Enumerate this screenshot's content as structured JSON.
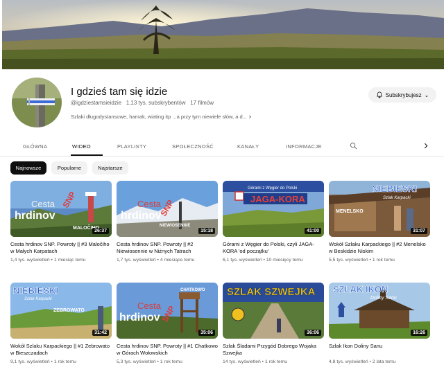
{
  "channel": {
    "title": "I gdzieś tam się idzie",
    "handle": "@igdziestamsieidzie",
    "subscribers": "1,13 tys. subskrybentów",
    "videos_count": "17 filmów",
    "description": "Szlaki długodystansowe, hamak, wiating itp ...a przy tym niewiele słów, a d...",
    "subscribe_label": "Subskrybujesz"
  },
  "tabs": [
    "GŁÓWNA",
    "WIDEO",
    "PLAYLISTY",
    "SPOŁECZNOŚĆ",
    "KANAŁY",
    "INFORMACJE"
  ],
  "active_tab": "WIDEO",
  "chips": [
    "Najnowsze",
    "Popularne",
    "Najstarsze"
  ],
  "active_chip": "Najnowsze",
  "icons": [
    "bell-icon",
    "search-icon",
    "chevron-right-icon",
    "chevron-right-small-icon"
  ],
  "videos": [
    {
      "title": "Cesta hrdinov SNP. Powroty || #3 Maločiho w Małych Karpatach",
      "views": "1,4 tys. wyświetleń",
      "age": "1 miesiąc temu",
      "duration": "26:37",
      "thumb_text": [
        "Cesta",
        "hrdinov",
        "SNP",
        "MALOČIHO"
      ]
    },
    {
      "title": "Cesta hrdinov SNP. Powroty || #2 Niewiosennie w Niżnych Tatrach",
      "views": "1,7 tys. wyświetleń",
      "age": "4 miesiące temu",
      "duration": "15:18",
      "thumb_text": [
        "Cesta",
        "hrdinov",
        "SNP",
        "NIEWIOSENNIE"
      ]
    },
    {
      "title": "Górami z Węgier do Polski, czyli JAGA-KORA 'od początku'",
      "views": "6,1 tys. wyświetleń",
      "age": "10 miesięcy temu",
      "duration": "41:00",
      "thumb_text": [
        "Górami z Węgier do Polski",
        "JAGA-KORA"
      ]
    },
    {
      "title": "Wokół Szlaku Karpackiego || #2 Menelsko w Beskidzie Niskim",
      "views": "5,5 tys. wyświetleń",
      "age": "1 rok temu",
      "duration": "31:07",
      "thumb_text": [
        "NIEBIESKI",
        "Szlak Karpacki",
        "MENELSKO"
      ]
    },
    {
      "title": "Wokół Szlaku Karpackiego || #1 Zebrowato w Bieszczadach",
      "views": "9,1 tys. wyświetleń",
      "age": "1 rok temu",
      "duration": "31:42",
      "thumb_text": [
        "NIEBIESKI",
        "Szlak Karpacki",
        "ZEBROWATO"
      ]
    },
    {
      "title": "Cesta hrdinov SNP. Powroty || #1 Chatkowo w Górach Wołowskich",
      "views": "5,3 tys. wyświetleń",
      "age": "1 rok temu",
      "duration": "35:06",
      "thumb_text": [
        "Cesta",
        "hrdinov",
        "SNP",
        "CHATKOWO"
      ]
    },
    {
      "title": "Szlak Śladami Przygód Dobrego Wojaka Szwejka",
      "views": "14 tys. wyświetleń",
      "age": "1 rok temu",
      "duration": "36:06",
      "thumb_text": [
        "SZLAK SZWEJKA"
      ]
    },
    {
      "title": "Szlak Ikon Doliny Sanu",
      "views": "4,8 tys. wyświetleń",
      "age": "2 lata temu",
      "duration": "16:26",
      "thumb_text": [
        "SZLAK IKON",
        "Doliny Sanu"
      ]
    }
  ]
}
